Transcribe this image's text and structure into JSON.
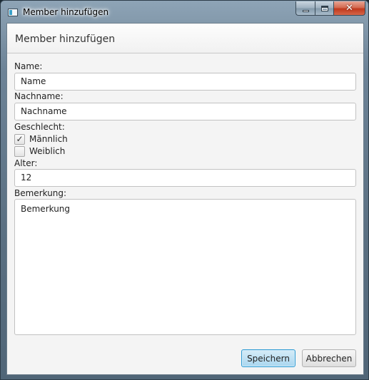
{
  "window": {
    "title": "Member hinzufügen",
    "close_glyph": "✕",
    "icons": [
      "app-icon",
      "minimize-icon",
      "maximize-icon",
      "close-icon"
    ]
  },
  "dialog": {
    "header_title": "Member hinzufügen"
  },
  "form": {
    "name_label": "Name:",
    "name_placeholder": "Name",
    "nachname_label": "Nachname:",
    "nachname_placeholder": "Nachname",
    "geschlecht_label": "Geschlecht:",
    "options": [
      {
        "label": "Männlich",
        "checked": true,
        "mark": "✓"
      },
      {
        "label": "Weiblich",
        "checked": false,
        "mark": ""
      }
    ],
    "alter_label": "Alter:",
    "alter_value": "12",
    "bemerkung_label": "Bemerkung:",
    "bemerkung_placeholder": "Bemerkung"
  },
  "buttons": {
    "save_label": "Speichern",
    "cancel_label": "Abbrechen"
  },
  "colors": {
    "primary_border": "#2e9bd4",
    "close_button": "#c0391d"
  }
}
